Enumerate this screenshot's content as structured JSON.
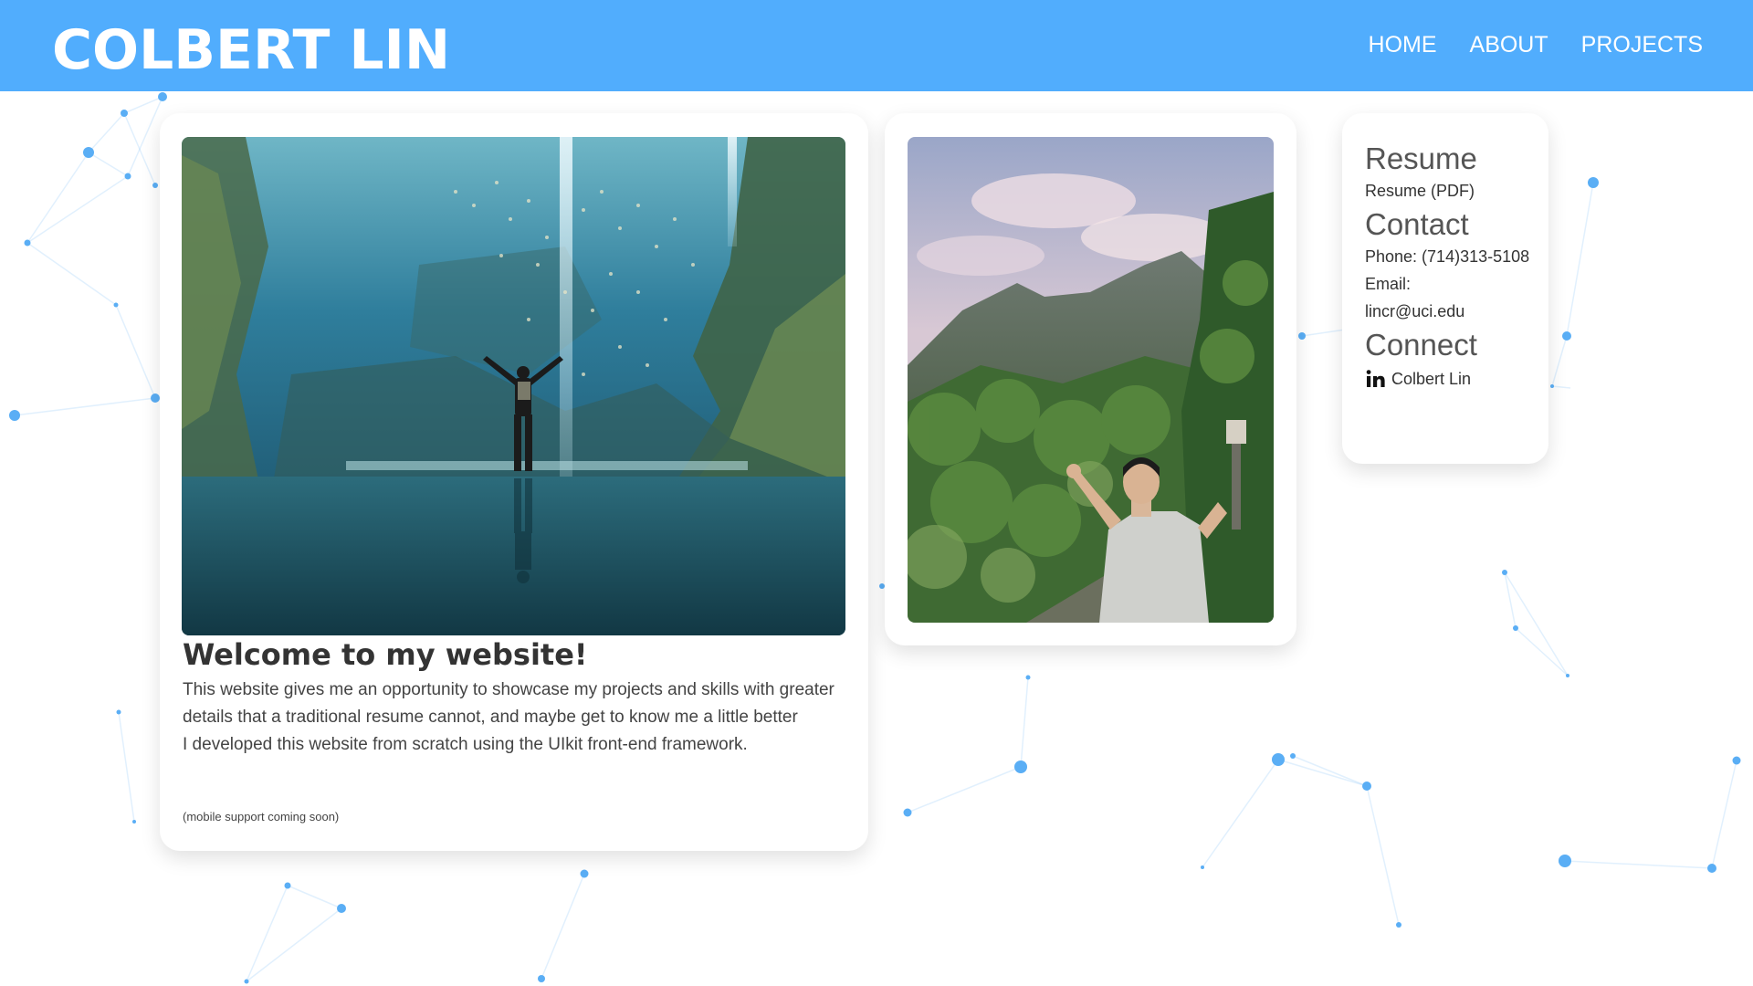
{
  "header": {
    "brand": "COLBERT LIN",
    "nav": [
      "HOME",
      "ABOUT",
      "PROJECTS"
    ]
  },
  "welcome": {
    "title": "Welcome to my website!",
    "paragraph1": "This website gives me an opportunity to showcase my projects and skills with greater details that a traditional resume cannot, and maybe get to know me a little better",
    "paragraph2": "I developed this website from scratch using the UIkit front-end framework.",
    "note": "(mobile support coming soon)"
  },
  "sidebar": {
    "resume_heading": "Resume",
    "resume_link": "Resume (PDF)",
    "contact_heading": "Contact",
    "phone": "Phone: (714)313-5108",
    "email_label": "Email:",
    "email": "lincr@uci.edu",
    "connect_heading": "Connect",
    "linkedin_label": "Colbert Lin"
  },
  "colors": {
    "navbar": "#51adfd",
    "accent": "#51adfd",
    "network_dots": "#5aaef5"
  },
  "icons": {
    "linkedin": "linkedin-icon"
  }
}
